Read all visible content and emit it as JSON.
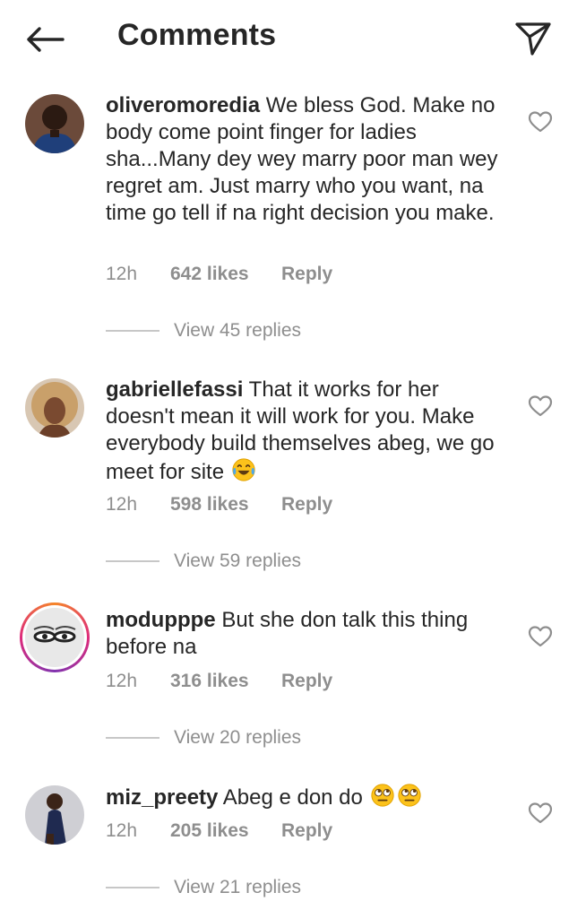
{
  "header": {
    "title": "Comments",
    "back_icon": "arrow-left-icon",
    "share_icon": "paper-plane-icon"
  },
  "comments": [
    {
      "username": "oliveromoredia",
      "text": "We bless God. Make no body come point finger for ladies sha...Many dey wey marry poor man wey regret am. Just marry who you want, na time go tell if na right decision you make.",
      "time": "12h",
      "likes": "642 likes",
      "reply": "Reply",
      "view_replies": "View 45 replies"
    },
    {
      "username": "gabriellefassi",
      "text": "That it works for her doesn't mean it will work for you. Make everybody build themselves abeg, we go meet for site",
      "emoji": [
        "face-with-tears-of-joy"
      ],
      "time": "12h",
      "likes": "598 likes",
      "reply": "Reply",
      "view_replies": "View 59 replies"
    },
    {
      "username": "modupppe",
      "text": "But she don talk this thing before na",
      "time": "12h",
      "likes": "316 likes",
      "reply": "Reply",
      "view_replies": "View 20 replies",
      "has_story_ring": true
    },
    {
      "username": "miz_preety",
      "text": "Abeg e don do",
      "emoji": [
        "face-with-rolling-eyes",
        "face-with-rolling-eyes"
      ],
      "time": "12h",
      "likes": "205 likes",
      "reply": "Reply",
      "view_replies": "View 21 replies"
    }
  ],
  "colors": {
    "text_primary": "#262626",
    "text_secondary": "#8e8e8e",
    "story_ring_start": "#f58529",
    "story_ring_end": "#dd2a7b"
  }
}
